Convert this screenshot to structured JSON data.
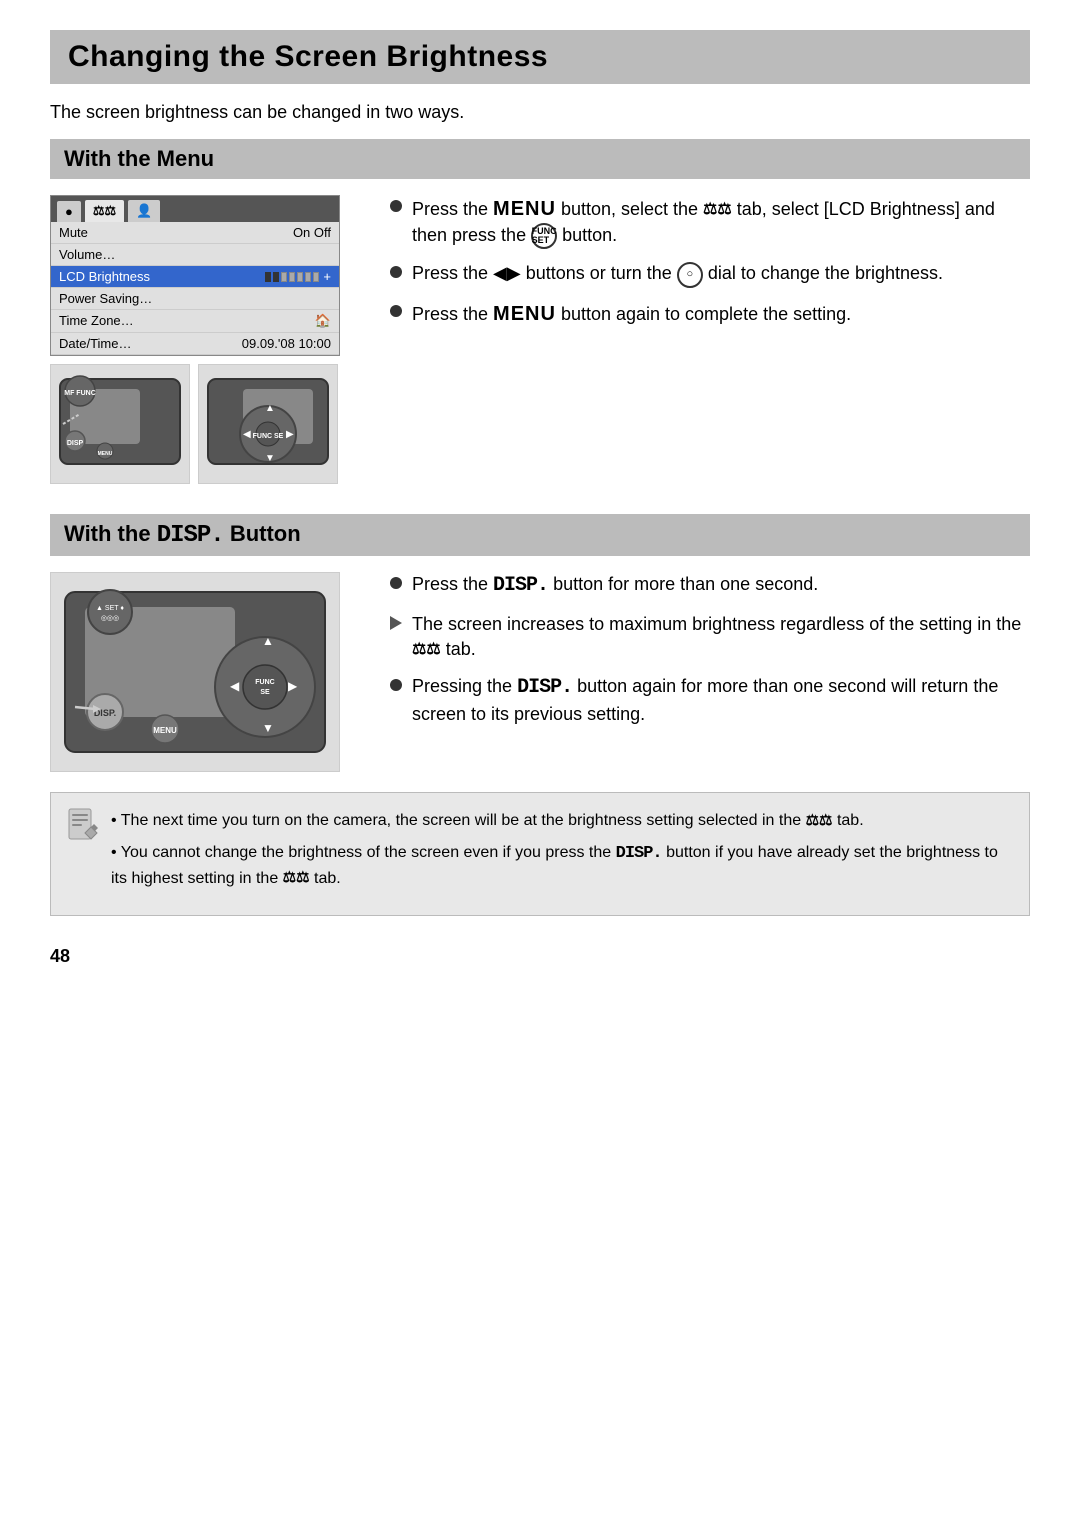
{
  "page": {
    "title": "Changing the Screen Brightness",
    "intro": "The screen brightness can be changed in two ways.",
    "section1": {
      "header": "With the Menu"
    },
    "section2": {
      "header_pre": "With the ",
      "header_disp": "DISP.",
      "header_post": " Button"
    },
    "menu": {
      "tabs": [
        "camera-icon",
        "tools-icon",
        "person-icon"
      ],
      "rows": [
        {
          "label": "Mute",
          "value": "On  Off"
        },
        {
          "label": "Volume…",
          "value": ""
        },
        {
          "label": "LCD Brightness",
          "value": "bar",
          "highlighted": true
        },
        {
          "label": "Power Saving…",
          "value": ""
        },
        {
          "label": "Time Zone…",
          "value": "🏠"
        },
        {
          "label": "Date/Time…",
          "value": "09.09.'08 10:00"
        }
      ]
    },
    "bullets_menu": [
      {
        "type": "circle",
        "text_pre": "Press the ",
        "menu_keyword": "MENU",
        "text_mid": " button, select the ",
        "tools_icon": "♦♦",
        "text_post": " tab, select [LCD Brightness] and then press the ",
        "func_label": "FUNC SET",
        "text_end": " button."
      },
      {
        "type": "circle",
        "text_pre": "Press the ◀▶ buttons or turn the ",
        "dial": "○",
        "text_post": " dial to change the brightness."
      },
      {
        "type": "circle",
        "text_pre": "Press the ",
        "menu_keyword": "MENU",
        "text_post": " button again to complete the setting."
      }
    ],
    "bullets_disp": [
      {
        "type": "circle",
        "text_pre": "Press the ",
        "disp_keyword": "DISP.",
        "text_post": " button for more than one second."
      },
      {
        "type": "triangle",
        "text": "The screen increases to maximum brightness regardless of the setting in the ",
        "tools_icon": "♦♦",
        "text_post": " tab."
      },
      {
        "type": "circle",
        "text_pre": "Pressing the ",
        "disp_keyword": "DISP.",
        "text_post": " button again for more than one second will return the screen to its previous setting."
      }
    ],
    "notes": [
      {
        "text_pre": "The next time you turn on the camera, the screen will be at the brightness setting selected in the ",
        "tools_icon": "♦♦",
        "text_post": " tab."
      },
      {
        "text_pre": "You cannot change the brightness of the screen even if you press the ",
        "disp_keyword": "DISP.",
        "text_mid": " button if you have already set the brightness to its highest setting in the ",
        "tools_icon": "♦♦",
        "text_post": " tab."
      }
    ],
    "page_number": "48"
  }
}
